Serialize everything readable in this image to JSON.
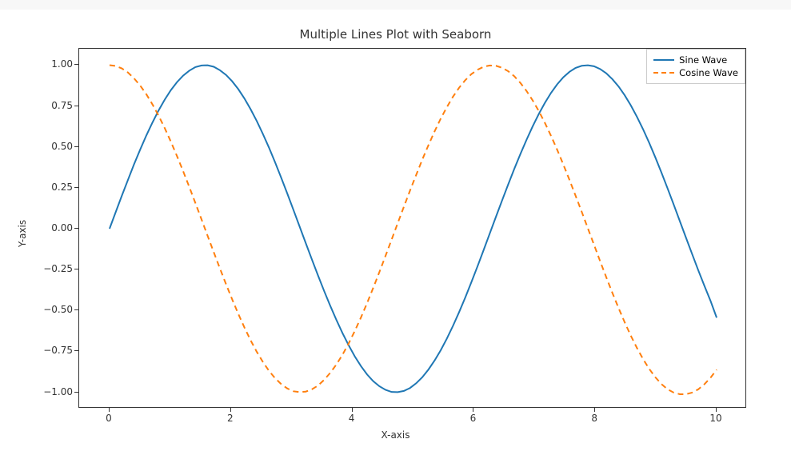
{
  "chart_data": {
    "type": "line",
    "title": "Multiple Lines Plot with Seaborn",
    "xlabel": "X-axis",
    "ylabel": "Y-axis",
    "xlim": [
      -0.5,
      10.5
    ],
    "ylim": [
      -1.1,
      1.1
    ],
    "xticks": [
      0,
      2,
      4,
      6,
      8,
      10
    ],
    "yticks": [
      -1.0,
      -0.75,
      -0.5,
      -0.25,
      0.0,
      0.25,
      0.5,
      0.75,
      1.0
    ],
    "x": [
      0.0,
      0.101,
      0.202,
      0.303,
      0.404,
      0.505,
      0.606,
      0.707,
      0.808,
      0.909,
      1.01,
      1.111,
      1.212,
      1.313,
      1.414,
      1.515,
      1.616,
      1.717,
      1.818,
      1.919,
      2.02,
      2.121,
      2.222,
      2.323,
      2.424,
      2.525,
      2.626,
      2.727,
      2.828,
      2.929,
      3.03,
      3.131,
      3.232,
      3.333,
      3.434,
      3.535,
      3.636,
      3.737,
      3.838,
      3.939,
      4.04,
      4.141,
      4.242,
      4.343,
      4.444,
      4.545,
      4.646,
      4.747,
      4.848,
      4.949,
      5.051,
      5.152,
      5.253,
      5.354,
      5.455,
      5.556,
      5.657,
      5.758,
      5.859,
      5.96,
      6.061,
      6.162,
      6.263,
      6.364,
      6.465,
      6.566,
      6.667,
      6.768,
      6.869,
      6.97,
      7.071,
      7.172,
      7.273,
      7.374,
      7.475,
      7.576,
      7.677,
      7.778,
      7.879,
      7.98,
      8.081,
      8.182,
      8.283,
      8.384,
      8.485,
      8.586,
      8.687,
      8.788,
      8.889,
      8.99,
      9.091,
      9.192,
      9.293,
      9.394,
      9.495,
      9.596,
      9.697,
      9.798,
      9.899,
      10.0
    ],
    "series": [
      {
        "name": "Sine Wave",
        "label": "Sine Wave",
        "color": "#1f77b4",
        "dash": "solid",
        "y": [
          0.0,
          0.101,
          0.201,
          0.298,
          0.394,
          0.484,
          0.57,
          0.649,
          0.723,
          0.789,
          0.847,
          0.896,
          0.936,
          0.966,
          0.988,
          0.998,
          0.999,
          0.99,
          0.969,
          0.94,
          0.901,
          0.853,
          0.796,
          0.731,
          0.659,
          0.58,
          0.496,
          0.406,
          0.311,
          0.214,
          0.114,
          0.013,
          -0.088,
          -0.188,
          -0.286,
          -0.381,
          -0.472,
          -0.558,
          -0.639,
          -0.713,
          -0.781,
          -0.84,
          -0.891,
          -0.932,
          -0.963,
          -0.985,
          -0.998,
          -0.999,
          -0.992,
          -0.974,
          -0.945,
          -0.908,
          -0.861,
          -0.806,
          -0.743,
          -0.672,
          -0.594,
          -0.51,
          -0.421,
          -0.327,
          -0.23,
          -0.13,
          -0.029,
          0.072,
          0.172,
          0.27,
          0.366,
          0.457,
          0.544,
          0.626,
          0.702,
          0.77,
          0.831,
          0.883,
          0.926,
          0.959,
          0.983,
          0.996,
          0.999,
          0.993,
          0.976,
          0.95,
          0.914,
          0.87,
          0.816,
          0.754,
          0.684,
          0.608,
          0.525,
          0.436,
          0.343,
          0.246,
          0.147,
          0.046,
          -0.055,
          -0.155,
          -0.254,
          -0.349,
          -0.441,
          -0.544
        ]
      },
      {
        "name": "Cosine Wave",
        "label": "Cosine Wave",
        "color": "#ff7f0e",
        "dash": "6,5",
        "y": [
          1.0,
          0.995,
          0.98,
          0.955,
          0.919,
          0.875,
          0.822,
          0.76,
          0.691,
          0.615,
          0.532,
          0.444,
          0.352,
          0.256,
          0.157,
          0.057,
          -0.044,
          -0.144,
          -0.243,
          -0.339,
          -0.432,
          -0.521,
          -0.604,
          -0.682,
          -0.752,
          -0.814,
          -0.869,
          -0.914,
          -0.95,
          -0.977,
          -0.994,
          -0.999,
          -0.996,
          -0.982,
          -0.959,
          -0.924,
          -0.881,
          -0.83,
          -0.77,
          -0.701,
          -0.625,
          -0.543,
          -0.455,
          -0.362,
          -0.266,
          -0.167,
          -0.067,
          0.034,
          0.134,
          0.233,
          0.329,
          0.423,
          0.511,
          0.595,
          0.673,
          0.743,
          0.807,
          0.862,
          0.908,
          0.945,
          0.972,
          0.99,
          0.998,
          0.996,
          0.984,
          0.963,
          0.932,
          0.891,
          0.842,
          0.784,
          0.719,
          0.646,
          0.567,
          0.482,
          0.392,
          0.298,
          0.201,
          0.103,
          0.002,
          -0.098,
          -0.199,
          -0.297,
          -0.393,
          -0.485,
          -0.572,
          -0.654,
          -0.729,
          -0.797,
          -0.857,
          -0.908,
          -0.95,
          -0.982,
          -1.002,
          -1.012,
          -1.012,
          -1.002,
          -0.982,
          -0.951,
          -0.911,
          -0.862
        ]
      }
    ],
    "legend": {
      "position": "upper-right",
      "labels": [
        "Sine Wave",
        "Cosine Wave"
      ]
    }
  }
}
